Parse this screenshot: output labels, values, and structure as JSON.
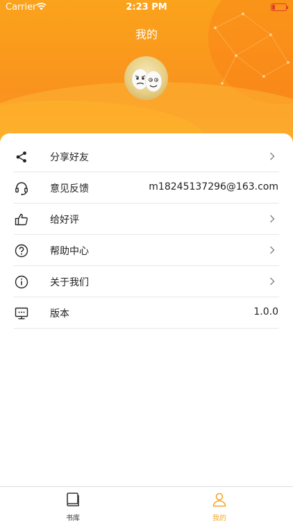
{
  "status_bar": {
    "carrier": "Carrier",
    "time": "2:23 PM"
  },
  "header": {
    "title": "我的"
  },
  "menu": [
    {
      "label": "分享好友",
      "icon": "share-icon",
      "value": "",
      "chevron": true
    },
    {
      "label": "意见反馈",
      "icon": "headset-icon",
      "value": "m18245137296@163.com",
      "chevron": false
    },
    {
      "label": "给好评",
      "icon": "thumbs-up-icon",
      "value": "",
      "chevron": true
    },
    {
      "label": "帮助中心",
      "icon": "question-circle-icon",
      "value": "",
      "chevron": true
    },
    {
      "label": "关于我们",
      "icon": "info-circle-icon",
      "value": "",
      "chevron": true
    },
    {
      "label": "版本",
      "icon": "monitor-icon",
      "value": "1.0.0",
      "chevron": false
    }
  ],
  "tabbar": {
    "tabs": [
      {
        "label": "书库",
        "icon": "book-icon",
        "active": false
      },
      {
        "label": "我的",
        "icon": "user-icon",
        "active": true
      }
    ]
  },
  "colors": {
    "brand": "#f9931d",
    "active_tab": "#f5a623",
    "inactive_tab": "#333333",
    "battery_low": "#e03a2a"
  }
}
